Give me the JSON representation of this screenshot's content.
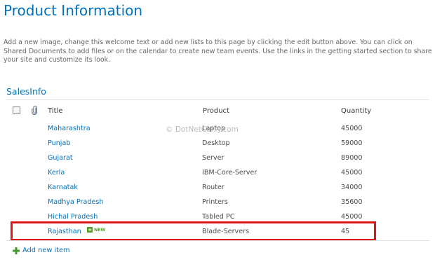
{
  "page": {
    "title": "Product Information",
    "intro": "Add a new image, change this welcome text or add new lists to this page by clicking the edit button above. You can click on Shared Documents to add files or on the calendar to create new team events. Use the links in the getting started section to share your site and customize its look."
  },
  "list": {
    "name": "SalesInfo",
    "columns": {
      "title": "Title",
      "product": "Product",
      "quantity": "Quantity"
    },
    "rows": [
      {
        "title": "Maharashtra",
        "product": "Laptop",
        "quantity": "45000"
      },
      {
        "title": "Punjab",
        "product": "Desktop",
        "quantity": "59000"
      },
      {
        "title": "Gujarat",
        "product": "Server",
        "quantity": "89000"
      },
      {
        "title": "Kerla",
        "product": "IBM-Core-Server",
        "quantity": "45000"
      },
      {
        "title": "Karnatak",
        "product": "Router",
        "quantity": "34000"
      },
      {
        "title": "Madhya Pradesh",
        "product": "Printers",
        "quantity": "35600"
      },
      {
        "title": "Hichal Pradesh",
        "product": "Tabled PC",
        "quantity": "45000"
      },
      {
        "title": "Rajasthan",
        "product": "Blade-Servers",
        "quantity": "45",
        "badge": "NEW"
      }
    ],
    "add_new_label": "Add new item"
  },
  "watermark": "© DotNetCurry.com",
  "colors": {
    "link": "#0072bc",
    "highlight": "#e0151b",
    "new_badge": "#5aa12a"
  }
}
